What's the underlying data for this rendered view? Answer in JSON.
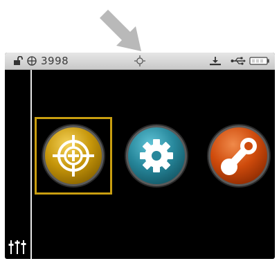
{
  "statusbar": {
    "lock_icon": "unlocked-padlock-icon",
    "globe_icon": "globe-icon",
    "counter": "3998",
    "center_icon": "crosshair-sun-icon",
    "download_icon": "download-tray-icon",
    "usb_icon": "usb-icon",
    "battery_icon": "battery-icon"
  },
  "main": {
    "apps": [
      {
        "id": "target",
        "icon": "target-crosshair-icon",
        "color": "#d9a80e",
        "selected": true
      },
      {
        "id": "settings",
        "icon": "gear-icon",
        "color": "#2f98ad"
      },
      {
        "id": "connect",
        "icon": "link-nodes-icon",
        "color": "#d8520f"
      }
    ],
    "sidebar": {
      "icon": "sliders-icon"
    }
  },
  "annotation": {
    "icon": "pointer-arrow-icon",
    "color": "#b9b9b9"
  },
  "colors": {
    "statusbar_bg": "#d6d6d6",
    "screen_bg": "#000000",
    "selection_border": "#c99e10"
  }
}
